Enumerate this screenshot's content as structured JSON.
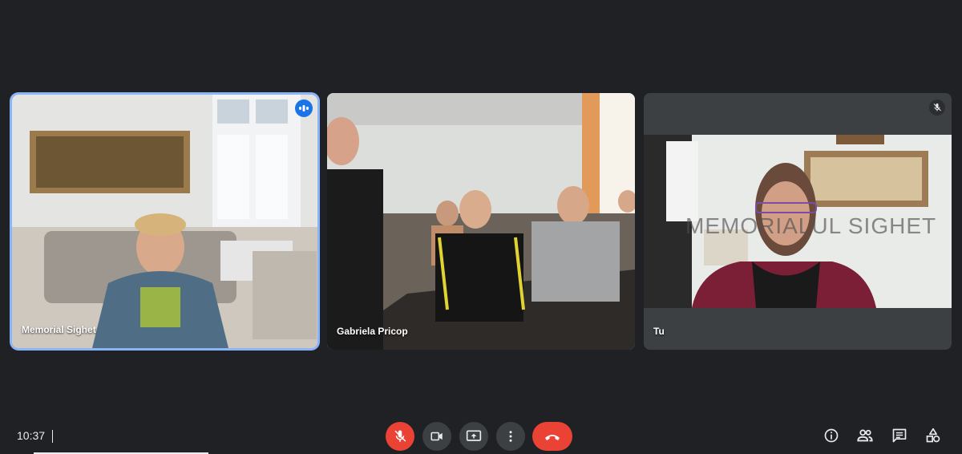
{
  "participants": [
    {
      "name": "Memorial Sighet",
      "state": "speaking"
    },
    {
      "name": "Gabriela Pricop",
      "state": "none"
    },
    {
      "name": "Tu",
      "state": "muted",
      "watermark": "MEMORIALUL SIGHET"
    }
  ],
  "footer": {
    "time": "10:37"
  },
  "controls": {
    "mic_icon": "mic-off-icon",
    "camera_icon": "videocam-icon",
    "present_icon": "present-screen-icon",
    "more_icon": "more-vert-icon",
    "hangup_icon": "call-end-icon"
  },
  "side_icons": [
    "info-icon",
    "people-icon",
    "chat-icon",
    "activities-icon"
  ],
  "colors": {
    "background": "#202124",
    "active_border": "#8ab4f8",
    "danger": "#ea4335",
    "control": "#3c4043"
  }
}
